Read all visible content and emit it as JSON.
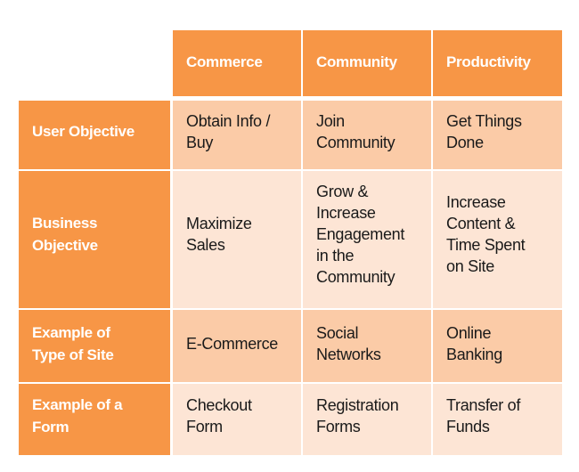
{
  "table": {
    "columns": [
      "Commerce",
      "Community",
      "Productivity"
    ],
    "rows": [
      {
        "label": "User Objective",
        "cells": [
          "Obtain Info /\nBuy",
          "Join\nCommunity",
          "Get Things\nDone"
        ]
      },
      {
        "label": "Business\nObjective",
        "cells": [
          "Maximize\nSales",
          "Grow &\nIncrease\nEngagement\nin the\nCommunity",
          "Increase\nContent &\nTime Spent\non Site"
        ]
      },
      {
        "label": "Example of\nType of Site",
        "cells": [
          "E-Commerce",
          "Social\nNetworks",
          "Online\nBanking"
        ]
      },
      {
        "label": "Example of a\nForm",
        "cells": [
          "Checkout\nForm",
          "Registration\nForms",
          "Transfer of\nFunds"
        ]
      }
    ]
  },
  "colors": {
    "header": "#F79646",
    "row_odd": "#FBCBA7",
    "row_even": "#FDE5D5",
    "header_text": "#FFFFFF",
    "body_text": "#1A1A1A"
  }
}
